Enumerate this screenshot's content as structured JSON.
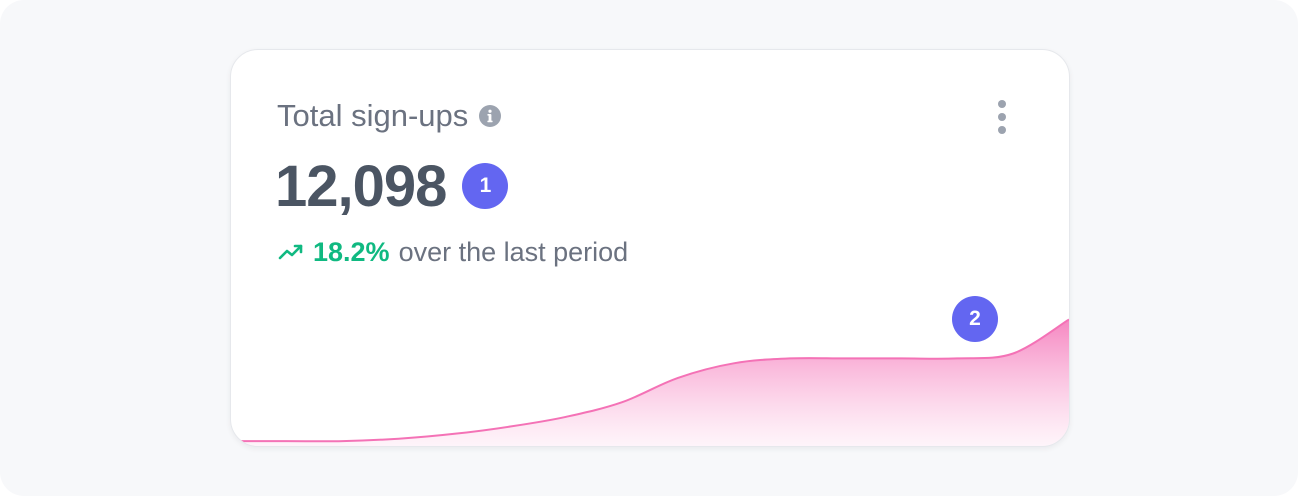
{
  "card": {
    "title": "Total sign-ups",
    "info_icon": "info-icon",
    "menu_icon": "more-vertical-icon",
    "value": "12,098",
    "markers": [
      "1",
      "2"
    ],
    "trend": {
      "icon": "trending-up-icon",
      "value": "18.2%",
      "text": "over the last period",
      "color": "#10b981"
    }
  },
  "colors": {
    "accent": "#6366f1",
    "sparkline": "#f472b6",
    "positive": "#10b981"
  },
  "chart_data": {
    "type": "area",
    "x": [
      0,
      1,
      2,
      3,
      4,
      5,
      6,
      7,
      8,
      9,
      10,
      11,
      12,
      13,
      14,
      15
    ],
    "values": [
      2,
      2,
      2,
      3,
      5,
      8,
      12,
      18,
      28,
      34,
      36,
      36,
      36,
      36,
      38,
      52
    ],
    "ylim": [
      0,
      60
    ],
    "title": "",
    "xlabel": "",
    "ylabel": "",
    "grid": false
  }
}
